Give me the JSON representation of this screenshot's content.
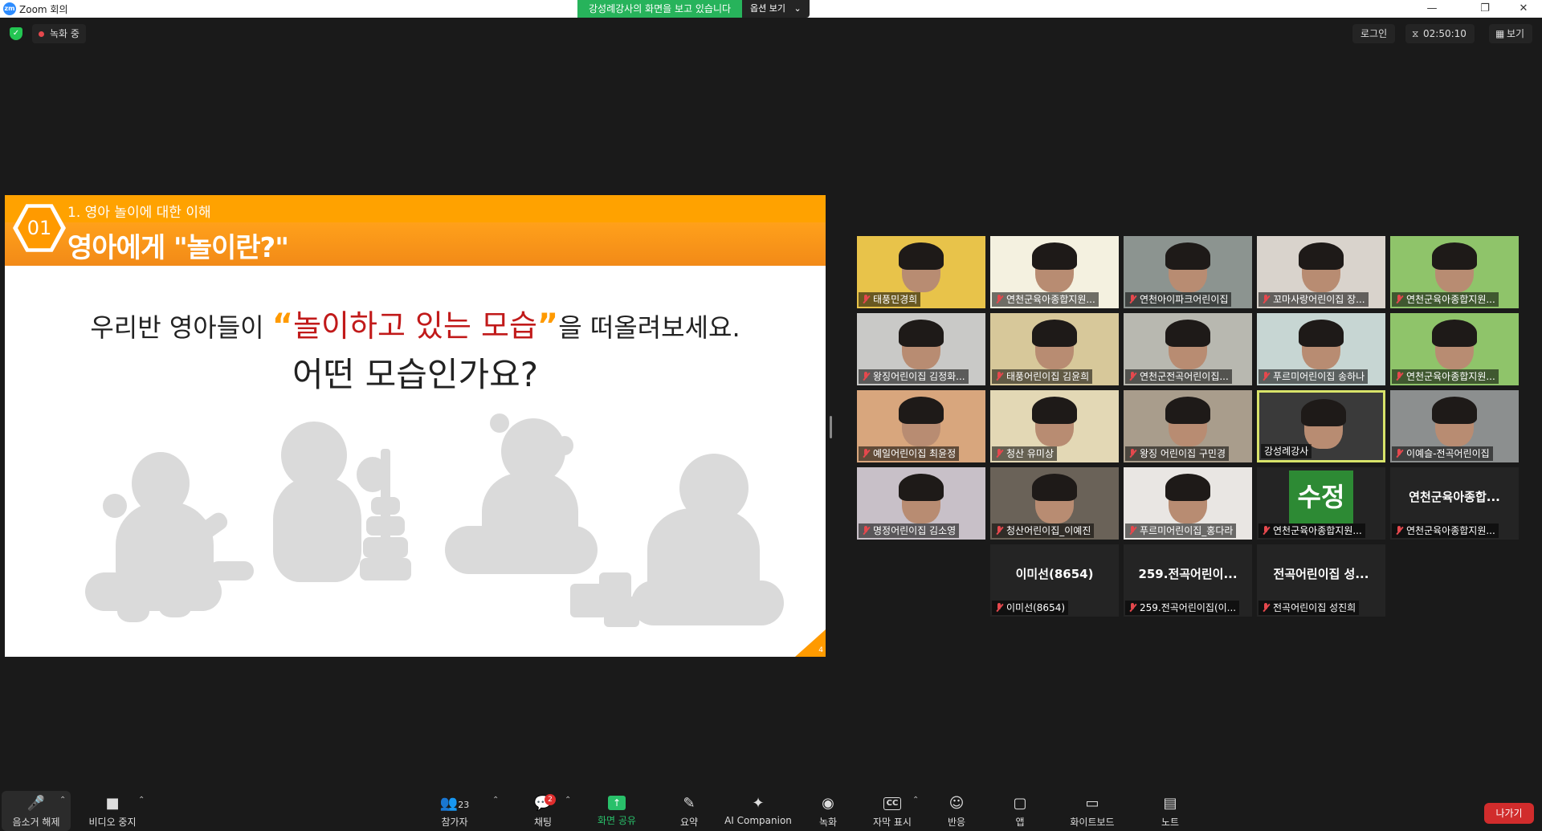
{
  "window": {
    "title": "Zoom 회의",
    "logo": "zm",
    "minimize": "—",
    "restore": "❐",
    "close": "✕"
  },
  "share_banner": {
    "message": "강성례강사의 화면을 보고 있습니다",
    "options_label": "옵션 보기",
    "caret": "⌄"
  },
  "topbar": {
    "recording_label": "녹화 중",
    "login_label": "로그인",
    "timer": "02:50:10",
    "view_label": "보기"
  },
  "slide": {
    "number": "01",
    "subtitle": "1. 영아 놀이에 대한 이해",
    "title": "영아에게 \"놀이란?\"",
    "line1_before": "우리반 영아들이 ",
    "line1_quote_open": "“",
    "line1_highlight": "놀이하고 있는 모습",
    "line1_quote_close": "”",
    "line1_after": "을 떠올려보세요.",
    "line2": "어떤 모습인가요?",
    "page": "4"
  },
  "gallery": {
    "tiles": [
      {
        "name": "태풍민경희",
        "muted": true,
        "bg": "#e8c34a"
      },
      {
        "name": "연천군육아종합지원...",
        "muted": true,
        "bg": "#f4f1e0"
      },
      {
        "name": "연천아이파크어린이집",
        "muted": true,
        "bg": "#8c9490"
      },
      {
        "name": "꼬마사랑어린이집 장...",
        "muted": true,
        "bg": "#d9d3cc"
      },
      {
        "name": "연천군육아종합지원...",
        "muted": true,
        "bg": "#8fc46a"
      },
      {
        "name": "왕징어린이집 김정화...",
        "muted": true,
        "bg": "#c9c9c7"
      },
      {
        "name": "태풍어린이집 김윤희",
        "muted": true,
        "bg": "#d7c89a"
      },
      {
        "name": "연천군전곡어린이집...",
        "muted": true,
        "bg": "#b8b8b0"
      },
      {
        "name": "푸르미어린이집 송하나",
        "muted": true,
        "bg": "#c7d6d3"
      },
      {
        "name": "연천군육아종합지원...",
        "muted": true,
        "bg": "#8fc46a"
      },
      {
        "name": "예일어린이집 최윤정",
        "muted": true,
        "bg": "#d8a67d"
      },
      {
        "name": "청산 유미상",
        "muted": true,
        "bg": "#e3d8b5"
      },
      {
        "name": "왕징 어린이집 구민경",
        "muted": true,
        "bg": "#a99d8c"
      },
      {
        "name": "강성례강사",
        "muted": false,
        "bg": "#3a3a3a"
      },
      {
        "name": "이예슬-전곡어린이집",
        "muted": true,
        "bg": "#8c8f8f"
      },
      {
        "name": "명정어린이집 김소영",
        "muted": true,
        "bg": "#c8c0c8"
      },
      {
        "name": "청산어린이집_이예진",
        "muted": true,
        "bg": "#6a6258"
      },
      {
        "name": "푸르미어린이집_홍다라",
        "muted": true,
        "bg": "#e9e6e3"
      },
      {
        "name": "연천군육아종합지원...",
        "muted": true,
        "bg": "#242424",
        "badge": "수정"
      },
      {
        "name": "연천군육아종합지원...",
        "muted": true,
        "bg": "#242424",
        "big": "연천군육아종합..."
      },
      {
        "name": "이미선(8654)",
        "muted": true,
        "bg": "#242424",
        "big": "이미선(8654)"
      },
      {
        "name": "259.전곡어린이집(이...",
        "muted": true,
        "bg": "#242424",
        "big": "259.전곡어린이..."
      },
      {
        "name": "전곡어린이집 성진희",
        "muted": true,
        "bg": "#242424",
        "big": "전곡어린이집 성..."
      }
    ]
  },
  "toolbar": {
    "unmute": "음소거 해제",
    "video": "비디오 중지",
    "participants": "참가자",
    "participants_count": "23",
    "chat": "채팅",
    "chat_badge": "2",
    "share": "화면 공유",
    "summary": "요약",
    "ai": "AI Companion",
    "record": "녹화",
    "captions": "자막 표시",
    "reactions": "반응",
    "apps": "앱",
    "whiteboard": "화이트보드",
    "notes": "노트",
    "leave": "나가기",
    "caret": "⌃"
  },
  "icons": {
    "mic": "🎤",
    "video": "■",
    "participants": "👥",
    "chat": "💬",
    "share": "↑",
    "summary": "✎",
    "ai": "✦",
    "record": "◉",
    "cc": "CC",
    "reactions": "☺",
    "apps": "▢",
    "whiteboard": "▭",
    "notes": "▤"
  },
  "colors": {
    "slide_accent": "#ff9a00",
    "highlight_red": "#c11a1a",
    "share_green": "#27b35b",
    "leave_red": "#d12c2c",
    "active_speaker": "#d8e36a"
  }
}
